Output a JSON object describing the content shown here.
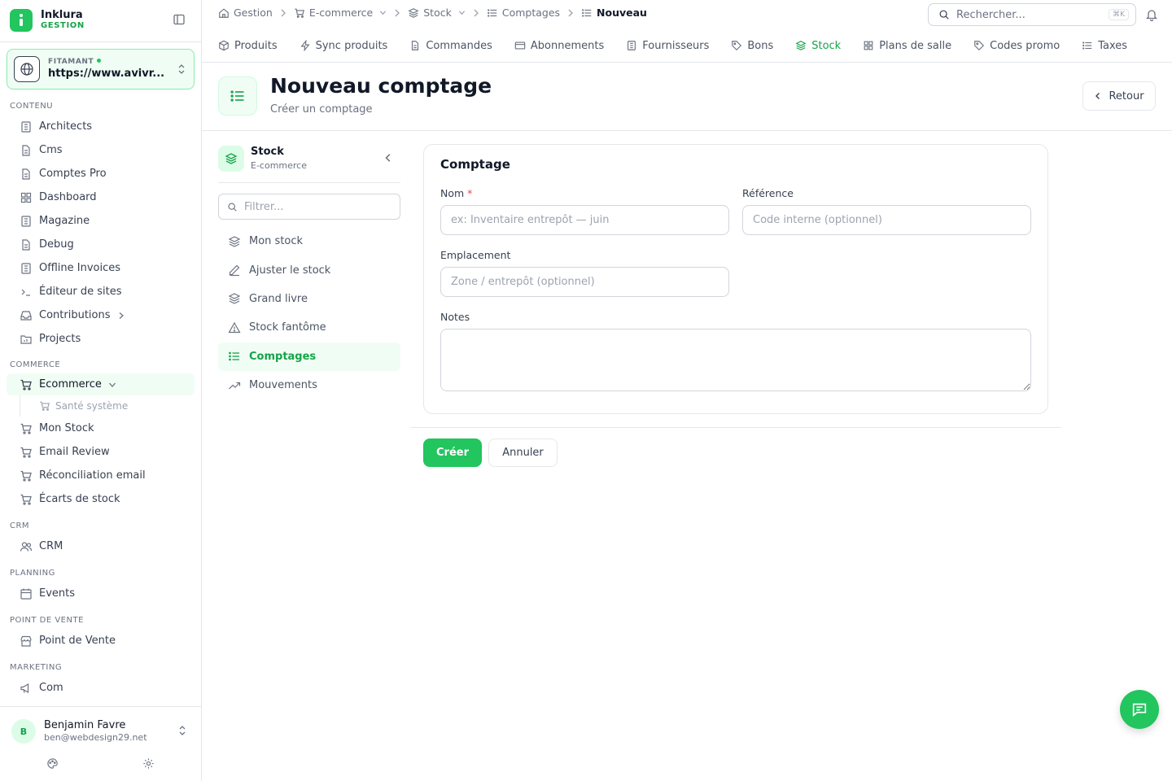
{
  "brand": {
    "name": "Inklura",
    "sub": "GESTION",
    "accent": "#22c55e"
  },
  "site": {
    "label": "FITAMANT",
    "url": "https://www.avivr..."
  },
  "sidebar": {
    "sections": [
      {
        "title": "CONTENU",
        "items": [
          "Architects",
          "Cms",
          "Comptes Pro",
          "Dashboard",
          "Magazine",
          "Debug",
          "Offline Invoices",
          "Éditeur de sites",
          "Contributions",
          "Projects"
        ]
      },
      {
        "title": "COMMERCE",
        "items": [
          "Ecommerce",
          "Santé système",
          "Mon Stock",
          "Email Review",
          "Réconciliation email",
          "Écarts de stock"
        ]
      },
      {
        "title": "CRM",
        "items": [
          "CRM"
        ]
      },
      {
        "title": "PLANNING",
        "items": [
          "Events"
        ]
      },
      {
        "title": "POINT DE VENTE",
        "items": [
          "Point de Vente"
        ]
      },
      {
        "title": "MARKETING",
        "items": [
          "Com"
        ]
      }
    ]
  },
  "user": {
    "initial": "B",
    "name": "Benjamin Favre",
    "email": "ben@webdesign29.net"
  },
  "breadcrumb": [
    "Gestion",
    "E-commerce",
    "Stock",
    "Comptages",
    "Nouveau"
  ],
  "search": {
    "placeholder": "Rechercher...",
    "shortcut": "⌘K"
  },
  "tabs": [
    "Produits",
    "Sync produits",
    "Commandes",
    "Abonnements",
    "Fournisseurs",
    "Bons",
    "Stock",
    "Plans de salle",
    "Codes promo",
    "Taxes"
  ],
  "page": {
    "title": "Nouveau comptage",
    "subtitle": "Créer un comptage",
    "back": "Retour"
  },
  "subnav": {
    "title": "Stock",
    "subtitle": "E-commerce",
    "filter_placeholder": "Filtrer...",
    "items": [
      "Mon stock",
      "Ajuster le stock",
      "Grand livre",
      "Stock fantôme",
      "Comptages",
      "Mouvements"
    ]
  },
  "form": {
    "title": "Comptage",
    "nom": {
      "label": "Nom",
      "required": "*",
      "placeholder": "ex: Inventaire entrepôt — juin"
    },
    "reference": {
      "label": "Référence",
      "placeholder": "Code interne (optionnel)"
    },
    "emplacement": {
      "label": "Emplacement",
      "placeholder": "Zone / entrepôt (optionnel)"
    },
    "notes": {
      "label": "Notes"
    },
    "submit": "Créer",
    "cancel": "Annuler"
  }
}
